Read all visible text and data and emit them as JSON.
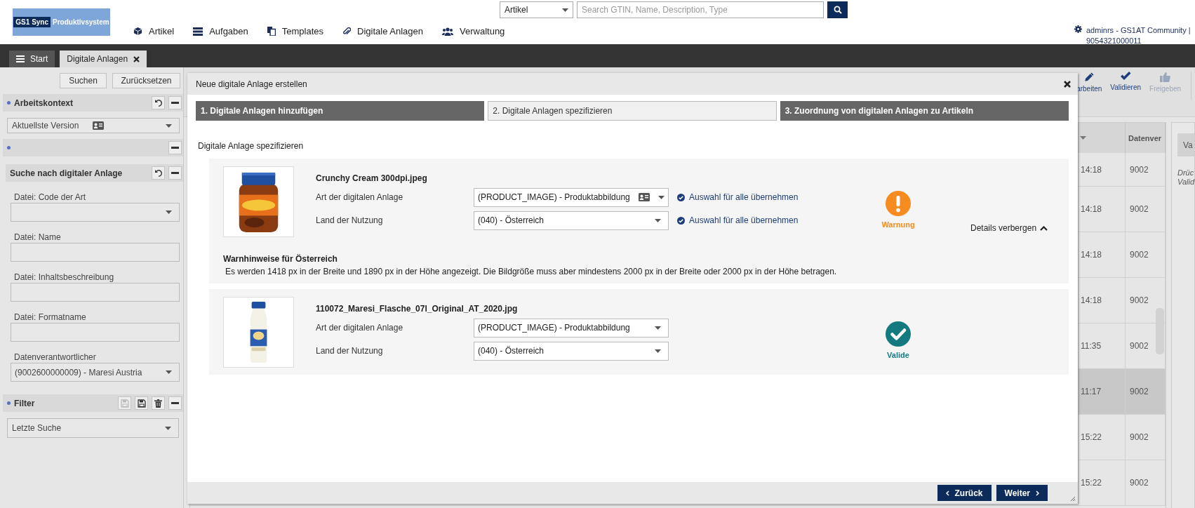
{
  "header": {
    "logo": {
      "brand": "GS1 Sync",
      "label": "Produktivsystem"
    },
    "search": {
      "scope": "Artikel",
      "placeholder": "Search GTIN, Name, Description, Type"
    },
    "nav": [
      {
        "label": "Artikel"
      },
      {
        "label": "Aufgaben"
      },
      {
        "label": "Templates"
      },
      {
        "label": "Digitale Anlagen"
      },
      {
        "label": "Verwaltung"
      }
    ],
    "user": {
      "name": "adminrs - GS1AT Community |",
      "id": "9054321000011"
    }
  },
  "tabs": [
    {
      "label": "Start",
      "selected": false
    },
    {
      "label": "Digitale Anlagen",
      "selected": true
    }
  ],
  "sidebar": {
    "buttons": [
      "Suchen",
      "Zurücksetzen"
    ],
    "work_context": {
      "title": "Arbeitskontext",
      "value": "Aktuellste Version"
    },
    "search_panel": {
      "title": "Suche nach digitaler Anlage",
      "fields": [
        {
          "label": "Datei: Code der Art",
          "kind": "select"
        },
        {
          "label": "Datei: Name",
          "kind": "text"
        },
        {
          "label": "Datei: Inhaltsbeschreibung",
          "kind": "text"
        },
        {
          "label": "Datei: Formatname",
          "kind": "text"
        },
        {
          "label": "Datenverantwortlicher",
          "kind": "select",
          "value": "(9002600000009) - Maresi Austria"
        }
      ]
    },
    "filter": {
      "title": "Filter",
      "value": "Letzte Suche",
      "tools": [
        {
          "kind": "save",
          "disabled": true
        },
        {
          "kind": "save",
          "disabled": false
        },
        {
          "kind": "delete",
          "disabled": false
        },
        {
          "kind": "minimize",
          "disabled": false
        }
      ]
    }
  },
  "toolbar": [
    {
      "label": "arbeiten",
      "disabled": false
    },
    {
      "label": "Validieren",
      "disabled": false
    },
    {
      "label": "Freigeben",
      "disabled": true
    }
  ],
  "table": {
    "heading": "Datenver",
    "rows": [
      {
        "cells": [
          "14:18",
          "9002"
        ],
        "selected": false
      },
      {
        "cells": [
          "14:18",
          "9002"
        ],
        "selected": false
      },
      {
        "cells": [
          "14:18",
          "9002"
        ],
        "selected": false
      },
      {
        "cells": [
          "14:18",
          "9002"
        ],
        "selected": false
      },
      {
        "cells": [
          "11:35",
          "9002"
        ],
        "selected": false
      },
      {
        "cells": [
          "11:17",
          "9002"
        ],
        "selected": true
      },
      {
        "cells": [
          "15:22",
          "9002"
        ],
        "selected": false
      },
      {
        "cells": [
          "15:22",
          "9002"
        ],
        "selected": false
      }
    ]
  },
  "right_panel": {
    "tab": "Va",
    "lines": [
      "Drüc",
      "Valid"
    ]
  },
  "modal": {
    "title": "Neue digitale Anlage erstellen",
    "steps": [
      {
        "label": "1. Digitale Anlagen hinzufügen",
        "selected": false
      },
      {
        "label": "2. Digitale Anlagen spezifizieren",
        "selected": true
      },
      {
        "label": "3. Zuordnung von digitalen Anlagen zu Artikeln",
        "selected": false
      }
    ],
    "heading": "Digitale Anlage spezifizieren",
    "items": [
      {
        "file": "Crunchy Cream 300dpi.jpeg",
        "fields": [
          {
            "label": "Art der digitalen Anlage",
            "value": "(PRODUCT_IMAGE) - Produktabbildung",
            "card_icon": true,
            "apply_all": "Auswahl für alle übernehmen"
          },
          {
            "label": "Land der Nutzung",
            "value": "(040) - Österreich",
            "card_icon": false,
            "apply_all": "Auswahl für alle übernehmen"
          }
        ],
        "status": {
          "kind": "warning",
          "label": "Warnung"
        },
        "details_toggle": "Details verbergen",
        "warning": {
          "title": "Warnhinweise für Österreich",
          "text": "Es werden 1418 px in der Breite und 1890 px in der Höhe angezeigt. Die Bildgröße muss aber mindestens 2000 px in der Breite oder 2000 px in der Höhe betragen."
        }
      },
      {
        "file": "110072_Maresi_Flasche_07l_Original_AT_2020.jpg",
        "fields": [
          {
            "label": "Art der digitalen Anlage",
            "value": "(PRODUCT_IMAGE) - Produktabbildung",
            "card_icon": false
          },
          {
            "label": "Land der Nutzung",
            "value": "(040) - Österreich",
            "card_icon": false
          }
        ],
        "status": {
          "kind": "valid",
          "label": "Valide"
        }
      }
    ],
    "buttons": [
      {
        "label": "Zurück",
        "kind": "back"
      },
      {
        "label": "Weiter",
        "kind": "next"
      }
    ]
  }
}
